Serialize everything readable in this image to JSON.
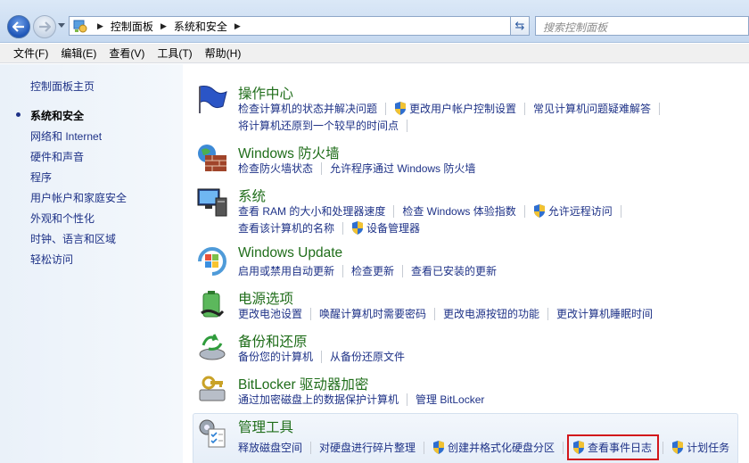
{
  "address": {
    "crumbs": [
      "控制面板",
      "系统和安全"
    ],
    "search_placeholder": "搜索控制面板"
  },
  "menu": [
    "文件(F)",
    "编辑(E)",
    "查看(V)",
    "工具(T)",
    "帮助(H)"
  ],
  "sidebar": {
    "items": [
      {
        "label": "控制面板主页",
        "current": false
      },
      {
        "label": "系统和安全",
        "current": true
      },
      {
        "label": "网络和 Internet",
        "current": false
      },
      {
        "label": "硬件和声音",
        "current": false
      },
      {
        "label": "程序",
        "current": false
      },
      {
        "label": "用户帐户和家庭安全",
        "current": false
      },
      {
        "label": "外观和个性化",
        "current": false
      },
      {
        "label": "时钟、语言和区域",
        "current": false
      },
      {
        "label": "轻松访问",
        "current": false
      }
    ]
  },
  "categories": [
    {
      "title": "操作中心",
      "icon": "flag-icon",
      "rows": [
        [
          {
            "text": "检查计算机的状态并解决问题"
          },
          {
            "text": "更改用户帐户控制设置",
            "shield": true
          },
          {
            "text": "常见计算机问题疑难解答"
          }
        ],
        [
          {
            "text": "将计算机还原到一个较早的时间点"
          }
        ]
      ]
    },
    {
      "title": "Windows 防火墙",
      "icon": "firewall-icon",
      "rows": [
        [
          {
            "text": "检查防火墙状态"
          },
          {
            "text": "允许程序通过 Windows 防火墙"
          }
        ]
      ]
    },
    {
      "title": "系统",
      "icon": "computer-icon",
      "rows": [
        [
          {
            "text": "查看 RAM 的大小和处理器速度"
          },
          {
            "text": "检查 Windows 体验指数"
          },
          {
            "text": "允许远程访问",
            "shield": true
          }
        ],
        [
          {
            "text": "查看该计算机的名称"
          },
          {
            "text": "设备管理器",
            "shield": true
          }
        ]
      ]
    },
    {
      "title": "Windows Update",
      "icon": "windows-update-icon",
      "rows": [
        [
          {
            "text": "启用或禁用自动更新"
          },
          {
            "text": "检查更新"
          },
          {
            "text": "查看已安装的更新"
          }
        ]
      ]
    },
    {
      "title": "电源选项",
      "icon": "power-icon",
      "rows": [
        [
          {
            "text": "更改电池设置"
          },
          {
            "text": "唤醒计算机时需要密码"
          },
          {
            "text": "更改电源按钮的功能"
          },
          {
            "text": "更改计算机睡眠时间"
          }
        ]
      ]
    },
    {
      "title": "备份和还原",
      "icon": "backup-icon",
      "rows": [
        [
          {
            "text": "备份您的计算机"
          },
          {
            "text": "从备份还原文件"
          }
        ]
      ]
    },
    {
      "title": "BitLocker 驱动器加密",
      "icon": "bitlocker-icon",
      "rows": [
        [
          {
            "text": "通过加密磁盘上的数据保护计算机",
            "shield": true
          },
          {
            "text": "管理 BitLocker"
          }
        ]
      ]
    },
    {
      "title": "管理工具",
      "icon": "admin-tools-icon",
      "rows": [
        [
          {
            "text": "释放磁盘空间"
          },
          {
            "text": "对硬盘进行碎片整理"
          },
          {
            "text": "创建并格式化硬盘分区",
            "shield": true
          },
          {
            "text": "查看事件日志",
            "shield": true,
            "highlight": true
          },
          {
            "text": "计划任务",
            "shield": true
          }
        ]
      ]
    }
  ],
  "colors": {
    "link": "#1e3287",
    "title": "#1f6d1a",
    "highlight": "#d2161b"
  }
}
